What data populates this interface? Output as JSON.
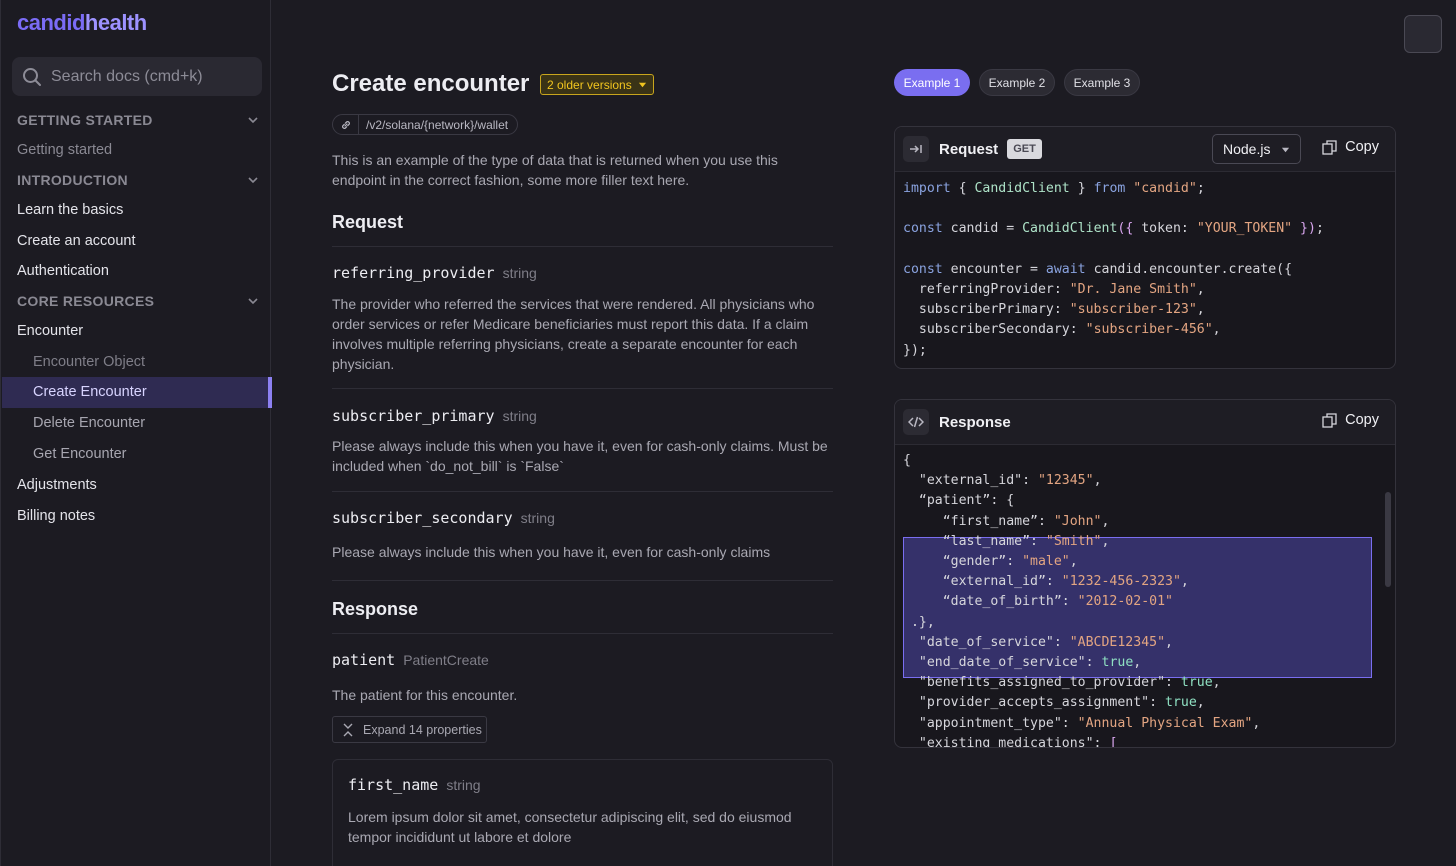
{
  "brand": {
    "part1": "candid",
    "part2": "health"
  },
  "search": {
    "placeholder": "Search docs (cmd+k)"
  },
  "sidebar": {
    "sections": [
      {
        "label": "GETTING STARTED"
      },
      {
        "label": "INTRODUCTION"
      },
      {
        "label": "CORE RESOURCES"
      }
    ],
    "items": [
      {
        "label": "Getting started"
      },
      {
        "label": "Learn the basics"
      },
      {
        "label": "Create an account"
      },
      {
        "label": "Authentication"
      },
      {
        "label": "Encounter"
      },
      {
        "label": "Encounter Object"
      },
      {
        "label": "Create Encounter"
      },
      {
        "label": "Delete Encounter"
      },
      {
        "label": "Get Encounter"
      },
      {
        "label": "Adjustments"
      },
      {
        "label": "Billing notes"
      }
    ]
  },
  "page": {
    "title": "Create encounter",
    "versions": "2 older versions",
    "endpoint": "/v2/solana/{network}/wallet",
    "description": "This is an example of the type of data that is returned when you use this endpoint in the correct fashion, some more filler text here.",
    "request_heading": "Request",
    "response_heading": "Response",
    "fields": [
      {
        "name": "referring_provider",
        "type": "string",
        "desc": "The provider who referred the services that were rendered. All physicians who order services or refer Medicare beneficiaries must report this data. If a claim involves multiple referring physicians, create a separate encounter for each physician."
      },
      {
        "name": "subscriber_primary",
        "type": "string",
        "desc": "Please always include this when you have it, even for cash-only claims. Must be included when `do_not_bill` is `False`"
      },
      {
        "name": "subscriber_secondary",
        "type": "string",
        "desc": "Please always include this when you have it, even for cash-only claims"
      }
    ],
    "response_field": {
      "name": "patient",
      "type": "PatientCreate",
      "desc": "The patient for this encounter."
    },
    "expand_label": "Expand 14 properties",
    "sub_field": {
      "name": "first_name",
      "type": "string",
      "desc": "Lorem ipsum dolor sit amet, consectetur adipiscing elit, sed do eiusmod tempor incididunt ut labore et dolore"
    }
  },
  "examples": [
    "Example 1",
    "Example 2",
    "Example 3"
  ],
  "request_card": {
    "title": "Request",
    "method": "GET",
    "language": "Node.js",
    "copy": "Copy"
  },
  "response_card": {
    "title": "Response",
    "copy": "Copy"
  },
  "colors": {
    "accent": "#7a6ef0",
    "active_row": "#2f2b52",
    "warning": "#f1c51f"
  }
}
